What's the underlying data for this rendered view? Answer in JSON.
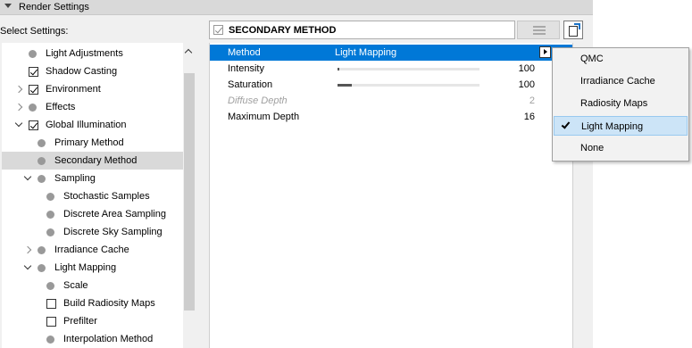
{
  "section": {
    "title": "Render Settings"
  },
  "select_label": "Select Settings:",
  "tree": [
    {
      "label": "Light Adjustments",
      "kind": "dot",
      "indent": 0,
      "expander": "none"
    },
    {
      "label": "Shadow Casting",
      "kind": "checkbox",
      "checked": true,
      "indent": 0,
      "expander": "none"
    },
    {
      "label": "Environment",
      "kind": "checkbox",
      "checked": true,
      "indent": 0,
      "expander": "closed"
    },
    {
      "label": "Effects",
      "kind": "dot",
      "indent": 0,
      "expander": "closed"
    },
    {
      "label": "Global Illumination",
      "kind": "checkbox",
      "checked": true,
      "indent": 0,
      "expander": "open"
    },
    {
      "label": "Primary Method",
      "kind": "dot",
      "indent": 1,
      "expander": "none"
    },
    {
      "label": "Secondary Method",
      "kind": "dot",
      "indent": 1,
      "expander": "none",
      "selected": true
    },
    {
      "label": "Sampling",
      "kind": "dot",
      "indent": 1,
      "expander": "open"
    },
    {
      "label": "Stochastic Samples",
      "kind": "dot",
      "indent": 2,
      "expander": "none"
    },
    {
      "label": "Discrete Area Sampling",
      "kind": "dot",
      "indent": 2,
      "expander": "none"
    },
    {
      "label": "Discrete Sky Sampling",
      "kind": "dot",
      "indent": 2,
      "expander": "none"
    },
    {
      "label": "Irradiance Cache",
      "kind": "dot",
      "indent": 1,
      "expander": "closed"
    },
    {
      "label": "Light Mapping",
      "kind": "dot",
      "indent": 1,
      "expander": "open"
    },
    {
      "label": "Scale",
      "kind": "dot",
      "indent": 2,
      "expander": "none"
    },
    {
      "label": "Build Radiosity Maps",
      "kind": "checkbox",
      "checked": false,
      "indent": 2,
      "expander": "none"
    },
    {
      "label": "Prefilter",
      "kind": "checkbox",
      "checked": false,
      "indent": 2,
      "expander": "none"
    },
    {
      "label": "Interpolation Method",
      "kind": "dot",
      "indent": 2,
      "expander": "none"
    }
  ],
  "header": {
    "title": "SECONDARY METHOD"
  },
  "properties": [
    {
      "name": "Method",
      "value": "Light Mapping",
      "selected": true
    },
    {
      "name": "Intensity",
      "number": "100",
      "slider": 0.0
    },
    {
      "name": "Saturation",
      "number": "100",
      "slider": 0.1
    },
    {
      "name": "Diffuse Depth",
      "number": "2",
      "disabled": true
    },
    {
      "name": "Maximum Depth",
      "number": "16"
    }
  ],
  "menu": {
    "items": [
      "QMC",
      "Irradiance Cache",
      "Radiosity Maps",
      "Light Mapping",
      "None"
    ],
    "selected_index": 3
  }
}
